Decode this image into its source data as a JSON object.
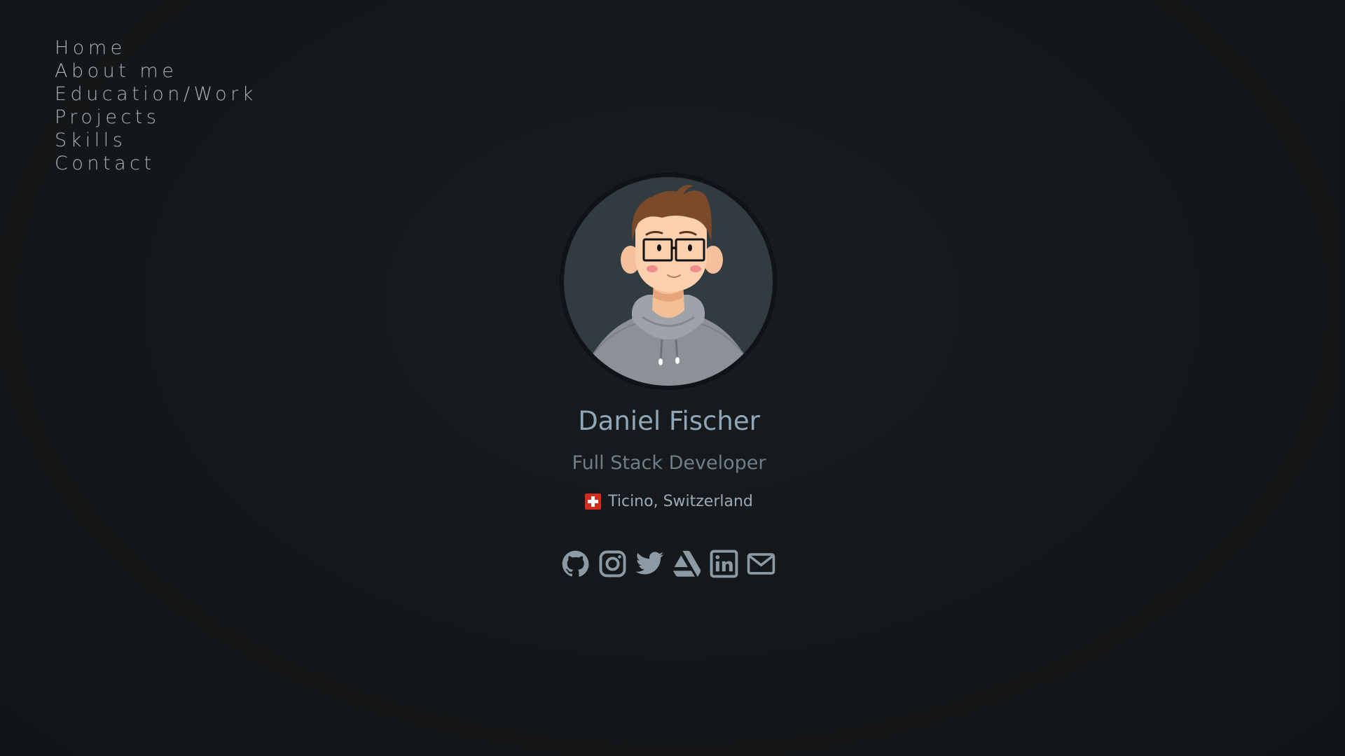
{
  "nav": {
    "items": [
      {
        "label": "Home"
      },
      {
        "label": "About me"
      },
      {
        "label": "Education/Work"
      },
      {
        "label": "Projects"
      },
      {
        "label": "Skills"
      },
      {
        "label": "Contact"
      }
    ]
  },
  "profile": {
    "name": "Daniel Fischer",
    "role": "Full Stack Developer",
    "location": "Ticino, Switzerland",
    "flag_icon": "swiss-flag-icon"
  },
  "socials": [
    {
      "icon": "github-icon"
    },
    {
      "icon": "instagram-icon"
    },
    {
      "icon": "twitter-icon"
    },
    {
      "icon": "artstation-icon"
    },
    {
      "icon": "linkedin-icon"
    },
    {
      "icon": "mail-icon"
    }
  ],
  "colors": {
    "background": "#15191b",
    "nav_text": "#b4bac0",
    "name": "#8fa7b8",
    "role": "#6f7f8a",
    "icon": "#8b9aa5"
  }
}
